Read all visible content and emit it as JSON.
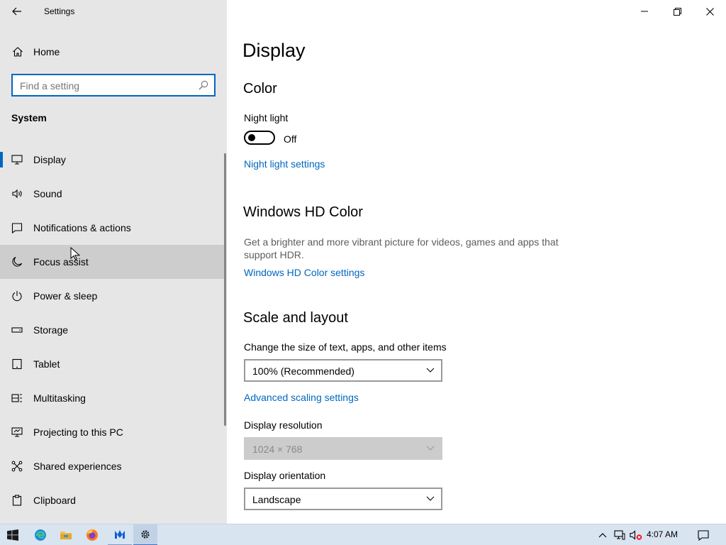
{
  "window": {
    "title": "Settings"
  },
  "nav": {
    "home_label": "Home",
    "search_placeholder": "Find a setting",
    "section_label": "System",
    "items": [
      {
        "label": "Display",
        "icon": "monitor-icon",
        "selected": true
      },
      {
        "label": "Sound",
        "icon": "speaker-icon"
      },
      {
        "label": "Notifications & actions",
        "icon": "notification-icon"
      },
      {
        "label": "Focus assist",
        "icon": "moon-icon",
        "hover": true
      },
      {
        "label": "Power & sleep",
        "icon": "power-icon"
      },
      {
        "label": "Storage",
        "icon": "storage-icon"
      },
      {
        "label": "Tablet",
        "icon": "tablet-icon"
      },
      {
        "label": "Multitasking",
        "icon": "multitasking-icon"
      },
      {
        "label": "Projecting to this PC",
        "icon": "projecting-icon"
      },
      {
        "label": "Shared experiences",
        "icon": "shared-experiences-icon"
      },
      {
        "label": "Clipboard",
        "icon": "clipboard-icon"
      }
    ]
  },
  "content": {
    "page_title": "Display",
    "color": {
      "heading": "Color",
      "night_light_label": "Night light",
      "night_light_state": "Off",
      "night_light_link": "Night light settings"
    },
    "hdr": {
      "heading": "Windows HD Color",
      "description": "Get a brighter and more vibrant picture for videos, games and apps that support HDR.",
      "link": "Windows HD Color settings"
    },
    "scale": {
      "heading": "Scale and layout",
      "size_label": "Change the size of text, apps, and other items",
      "size_value": "100% (Recommended)",
      "advanced_link": "Advanced scaling settings",
      "resolution_label": "Display resolution",
      "resolution_value": "1024 × 768",
      "orientation_label": "Display orientation",
      "orientation_value": "Landscape"
    }
  },
  "taskbar": {
    "time": "4:07 AM"
  },
  "colors": {
    "accent": "#0067c0",
    "nav_bg": "#e6e6e6",
    "hover_bg": "#cdcdcd",
    "taskbar_bg": "#d9e4f1"
  }
}
